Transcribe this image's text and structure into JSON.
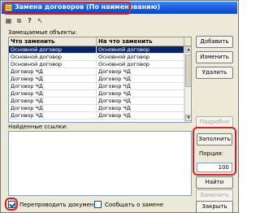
{
  "window": {
    "title": "Замена договоров (По наименованию)"
  },
  "toolbar": {
    "icons": [
      "save-icon",
      "copy-icon",
      "help-icon",
      "pointer-help-icon"
    ],
    "glyphs": [
      "▦",
      "⧉",
      "?",
      "↖"
    ]
  },
  "replaced": {
    "label": "Замещаемые объекты:",
    "columns": [
      "Что заменить",
      "На что заменить"
    ],
    "rows": [
      [
        "Основной договор",
        "Основной договор"
      ],
      [
        "Основной договор",
        "Основной договор"
      ],
      [
        "Основной договор",
        "Основной договор"
      ],
      [
        "Договор ЧД",
        "Договор ЧД"
      ],
      [
        "Договор ЧД",
        "Договор ЧД"
      ],
      [
        "Договор ЧД",
        "Договор ЧД"
      ],
      [
        "Договор ЧД",
        "Договор ЧД"
      ],
      [
        "Договор ЧД",
        "Договор ЧД"
      ],
      [
        "Договор ЧД",
        "Договор ЧД"
      ],
      [
        "Договор ЧД",
        "Договор ЧД"
      ]
    ],
    "selected_row": 0
  },
  "buttons": {
    "add": "Добавить",
    "change": "Изменить",
    "delete": "Удалить",
    "details": "Подробно",
    "fill": "Заполнить",
    "find": "Найти",
    "replace": "Заменить",
    "close": "Закрыть"
  },
  "refs": {
    "label": "Найденные ссылки:"
  },
  "portion": {
    "label": "Порция:",
    "value": "100"
  },
  "options": {
    "repost_label": "Перепроводить документы",
    "repost_checked": true,
    "notify_label": "Сообщать о замене",
    "notify_checked": false
  },
  "colors": {
    "titlebar": "#0a46c8",
    "highlight": "#d9202a",
    "selection": "#0a246a"
  }
}
